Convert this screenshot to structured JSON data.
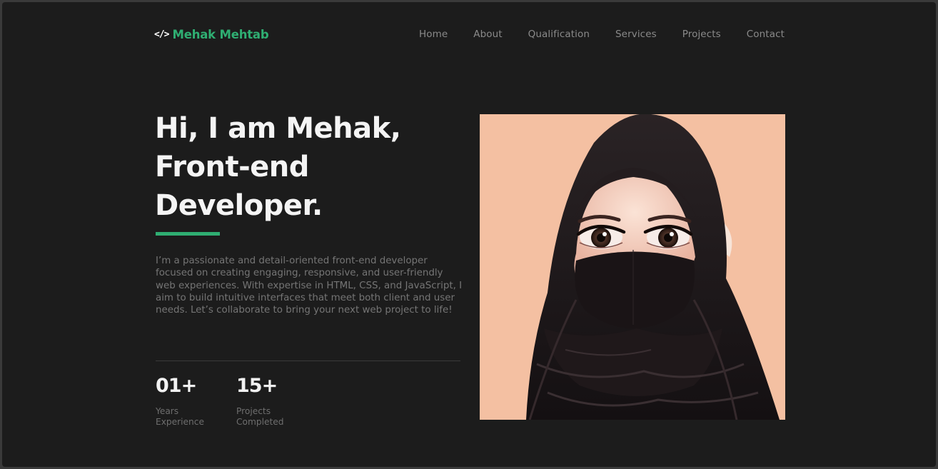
{
  "header": {
    "logo_icon": "</>",
    "logo_text": "Mehak Mehtab",
    "nav": [
      {
        "label": "Home"
      },
      {
        "label": "About"
      },
      {
        "label": "Qualification"
      },
      {
        "label": "Services"
      },
      {
        "label": "Projects"
      },
      {
        "label": "Contact"
      }
    ]
  },
  "hero": {
    "title_lines": [
      "Hi, I am Mehak,",
      "Front-end",
      "Developer."
    ],
    "bio": "I’m a passionate and detail-oriented front-end developer focused on creating engaging, responsive, and user-friendly web experiences. With expertise in HTML, CSS, and JavaScript, I aim to build intuitive interfaces that meet both client and user needs. Let’s collaborate to bring your next web project to life!",
    "stats": [
      {
        "value": "01+",
        "label_lines": [
          "Years",
          "Experience"
        ]
      },
      {
        "value": "15+",
        "label_lines": [
          "Projects",
          "Completed"
        ]
      }
    ],
    "portrait_icon": "hijab-avatar-illustration"
  },
  "colors": {
    "accent": "#2fae72",
    "background": "#1c1c1c",
    "portrait_bg": "#f4c0a2"
  }
}
